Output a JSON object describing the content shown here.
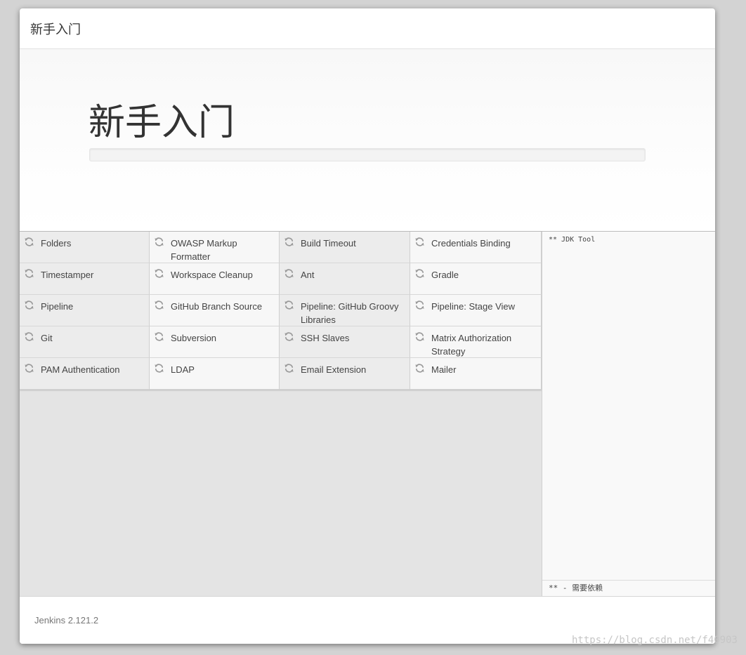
{
  "dialog": {
    "title": "新手入门",
    "hero_title": "新手入门",
    "progress_fraction": 0
  },
  "plugins": [
    {
      "name": "Folders"
    },
    {
      "name": "OWASP Markup Formatter"
    },
    {
      "name": "Build Timeout"
    },
    {
      "name": "Credentials Binding"
    },
    {
      "name": "Timestamper"
    },
    {
      "name": "Workspace Cleanup"
    },
    {
      "name": "Ant"
    },
    {
      "name": "Gradle"
    },
    {
      "name": "Pipeline"
    },
    {
      "name": "GitHub Branch Source"
    },
    {
      "name": "Pipeline: GitHub Groovy Libraries"
    },
    {
      "name": "Pipeline: Stage View"
    },
    {
      "name": "Git"
    },
    {
      "name": "Subversion"
    },
    {
      "name": "SSH Slaves"
    },
    {
      "name": "Matrix Authorization Strategy"
    },
    {
      "name": "PAM Authentication"
    },
    {
      "name": "LDAP"
    },
    {
      "name": "Email Extension"
    },
    {
      "name": "Mailer"
    }
  ],
  "plugin_icon": "refresh-icon",
  "log": {
    "text": "** JDK Tool",
    "footer": "** - 需要依赖"
  },
  "footer": {
    "version": "Jenkins 2.121.2"
  },
  "watermark": "https://blog.csdn.net/f40903",
  "colors": {
    "progress_fill": "#5ea85e",
    "backdrop": "#d3d3d3"
  }
}
